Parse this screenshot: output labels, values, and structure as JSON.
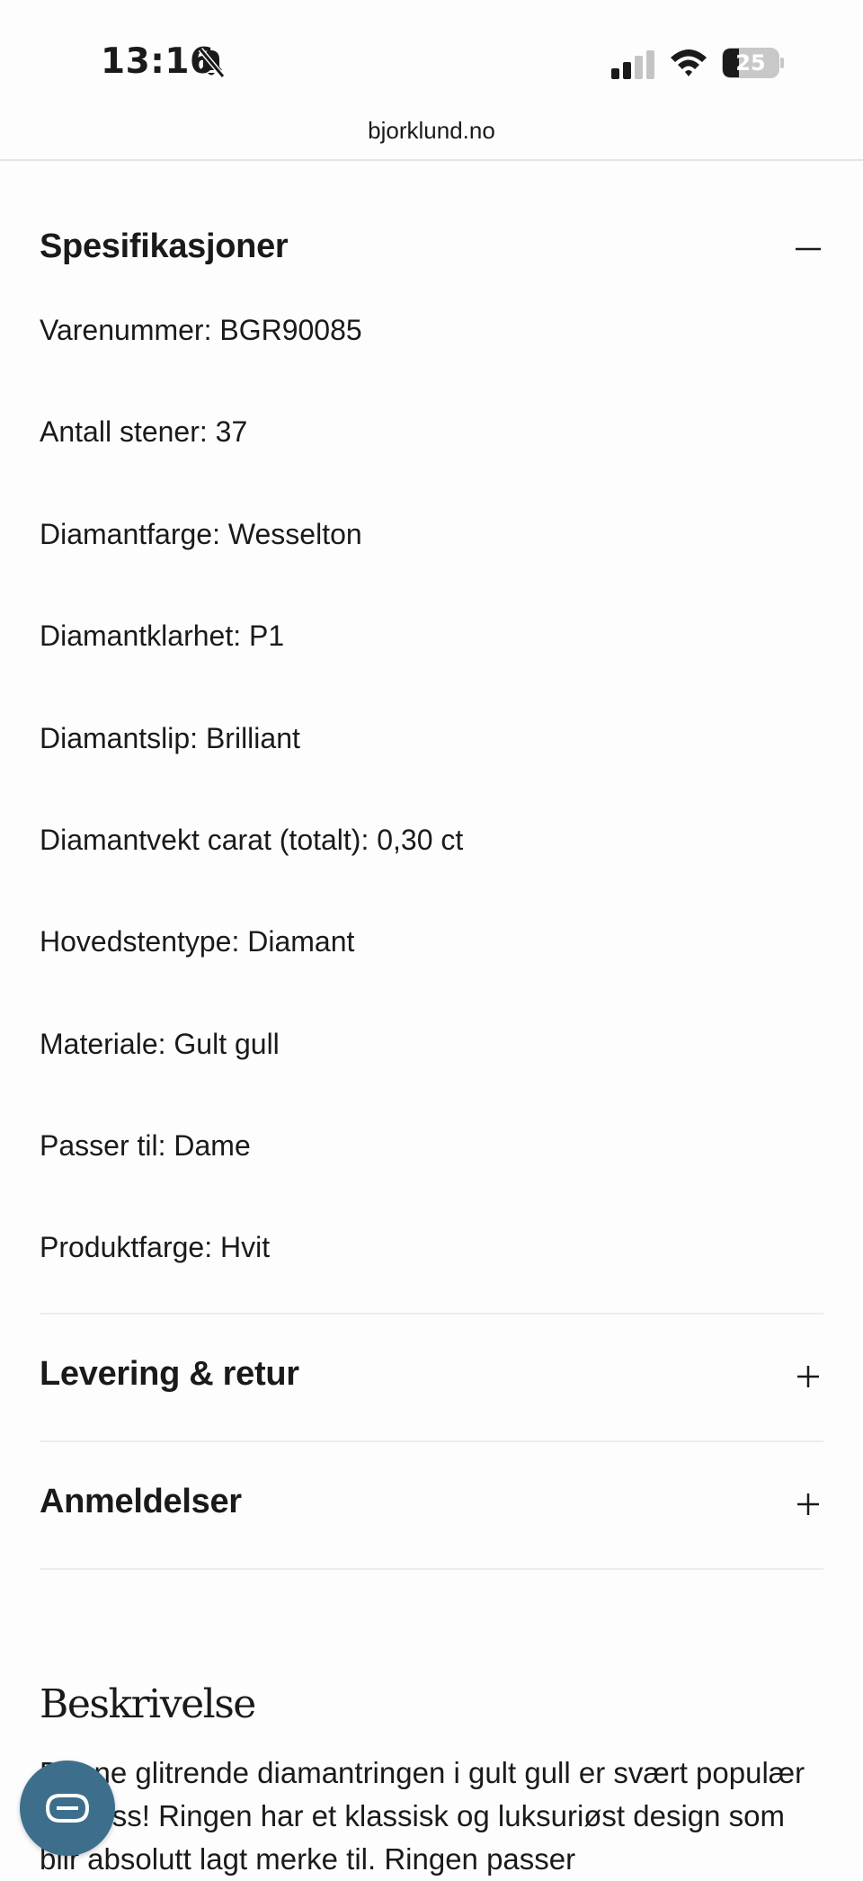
{
  "status_bar": {
    "time": "13:16",
    "battery": "25"
  },
  "browser": {
    "url": "bjorklund.no"
  },
  "specifications": {
    "title": "Spesifikasjoner",
    "items": [
      "Varenummer: BGR90085",
      "Antall stener: 37",
      "Diamantfarge: Wesselton",
      "Diamantklarhet: P1",
      "Diamantslip: Brilliant",
      "Diamantvekt carat (totalt): 0,30 ct",
      "Hovedstentype: Diamant",
      "Materiale: Gult gull",
      "Passer til: Dame",
      "Produktfarge: Hvit"
    ]
  },
  "delivery": {
    "title": "Levering & retur"
  },
  "reviews": {
    "title": "Anmeldelser"
  },
  "description": {
    "title": "Beskrivelse",
    "text": "Denne glitrende diamantringen i gult gull er svært populær hos oss! Ringen har et klassisk og luksuriøst design som blir absolutt lagt merke til. Ringen passer"
  },
  "icons": {
    "bell": "bell-slash-icon",
    "signal": "cellular-signal-icon",
    "wifi": "wifi-icon",
    "battery": "battery-icon",
    "collapse": "minus-icon",
    "expand": "plus-icon",
    "chat": "chat-icon"
  },
  "colors": {
    "chat_button": "#3d6f8c",
    "text": "#1a1a1a"
  }
}
